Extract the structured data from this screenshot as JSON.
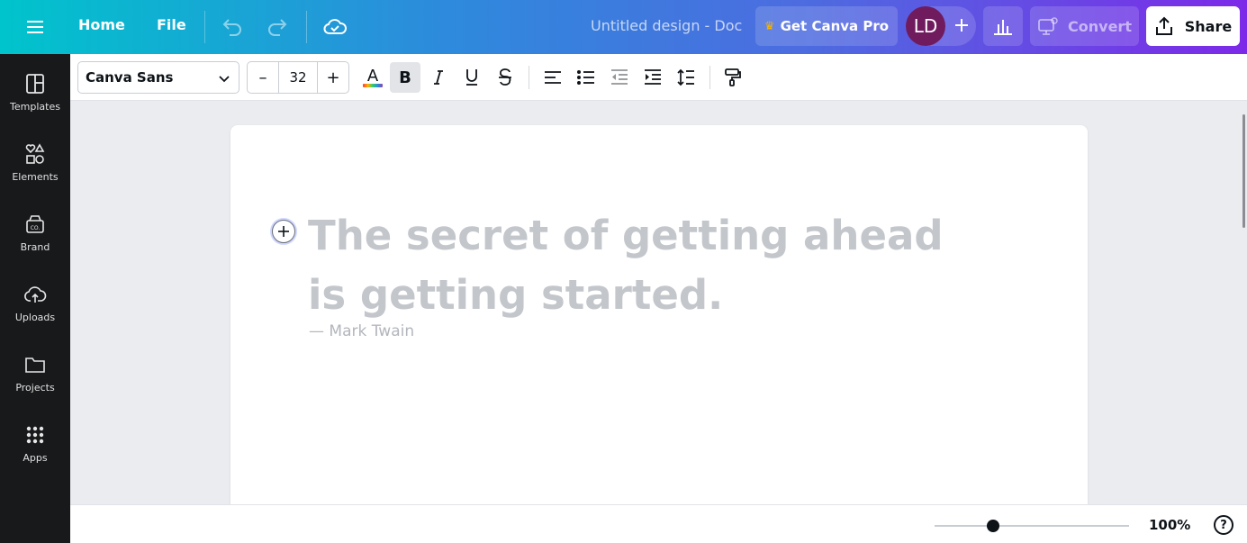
{
  "topbar": {
    "home_label": "Home",
    "file_label": "File",
    "doc_title": "Untitled design - Doc",
    "pro_label": "Get Canva Pro",
    "avatar_initials": "LD",
    "convert_label": "Convert",
    "share_label": "Share",
    "icons": [
      "menu-icon",
      "undo-icon",
      "redo-icon",
      "cloud-saved-icon",
      "crown-icon",
      "plus-icon",
      "bar-chart-icon",
      "convert-icon",
      "share-upload-icon"
    ],
    "colors": {
      "gradient_start": "#00c4cc",
      "gradient_end": "#7d2ae8",
      "avatar_bg": "#6f1b5e",
      "crown": "#f5b400"
    }
  },
  "sidebar": {
    "items": [
      {
        "label": "Templates",
        "icon": "templates-icon"
      },
      {
        "label": "Elements",
        "icon": "elements-icon"
      },
      {
        "label": "Brand",
        "icon": "brand-icon"
      },
      {
        "label": "Uploads",
        "icon": "upload-cloud-icon"
      },
      {
        "label": "Projects",
        "icon": "folder-icon"
      },
      {
        "label": "Apps",
        "icon": "apps-grid-icon"
      }
    ]
  },
  "toolbar": {
    "font_family": "Canva Sans",
    "font_size": "32",
    "decrease_label": "–",
    "increase_label": "+",
    "tools": [
      "text-color-icon",
      "bold-icon",
      "italic-icon",
      "underline-icon",
      "strikethrough-icon",
      "align-left-icon",
      "bullet-list-icon",
      "outdent-icon",
      "indent-icon",
      "line-spacing-icon",
      "format-painter-icon"
    ],
    "bold_active": true
  },
  "document": {
    "quote": "The secret of getting ahead is getting started.",
    "author": "— Mark Twain"
  },
  "bottombar": {
    "zoom_label": "100%",
    "zoom_value": 100,
    "help_label": "?"
  }
}
